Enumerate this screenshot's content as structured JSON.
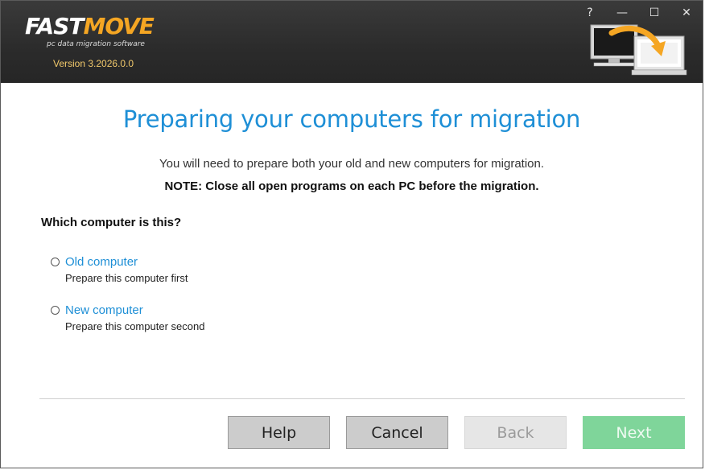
{
  "app": {
    "logo_fast": "FAST",
    "logo_move": "MOVE",
    "tagline": "pc data migration software",
    "version": "Version 3.2026.0.0"
  },
  "window_controls": {
    "help": "?",
    "minimize": "—",
    "maximize": "☐",
    "close": "✕"
  },
  "page": {
    "title": "Preparing your computers for migration",
    "subtitle": "You will need to prepare both your old and new computers for migration.",
    "note": "NOTE: Close all open programs on each PC before the migration.",
    "question": "Which computer is this?"
  },
  "options": [
    {
      "label": "Old computer",
      "description": "Prepare this computer first",
      "selected": false
    },
    {
      "label": "New computer",
      "description": "Prepare this computer second",
      "selected": false
    }
  ],
  "buttons": {
    "help": "Help",
    "cancel": "Cancel",
    "back": "Back",
    "next": "Next"
  },
  "colors": {
    "accent_blue": "#1e8fd6",
    "logo_orange": "#f5a623",
    "header_dark": "#2b2b2b",
    "next_green": "#7fd59a"
  }
}
